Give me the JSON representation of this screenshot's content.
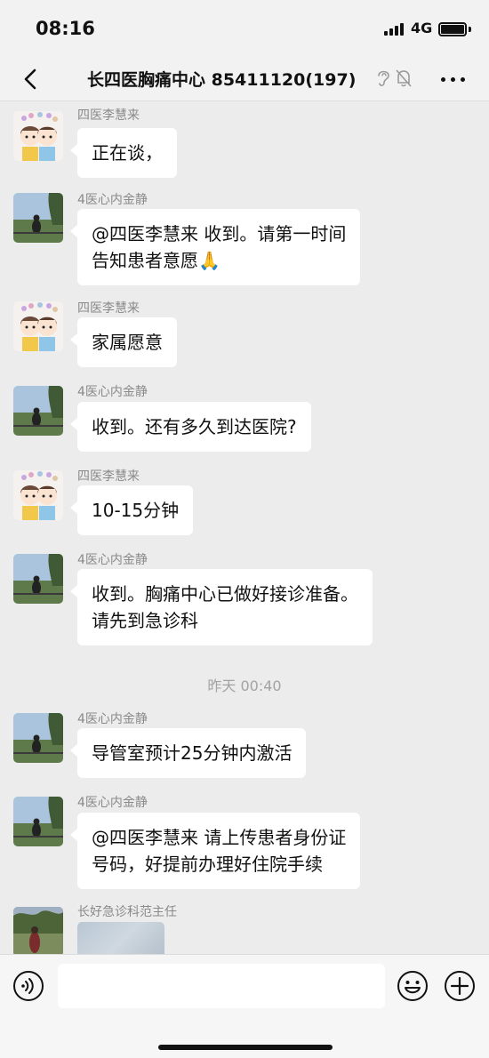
{
  "status_bar": {
    "time": "08:16",
    "network": "4G"
  },
  "header": {
    "title": "长四医胸痛中心 85411120(197)"
  },
  "messages": [
    {
      "sender": "四医李慧来",
      "text": "正在谈，",
      "avatar": "cartoon-couple"
    },
    {
      "sender": "4医心内金静",
      "line1": "@四医李慧来 收到。请第一时间",
      "line2": "告知患者意愿🙏",
      "avatar": "scenery"
    },
    {
      "sender": "四医李慧来",
      "text": "家属愿意",
      "avatar": "cartoon-couple"
    },
    {
      "sender": "4医心内金静",
      "text": "收到。还有多久到达医院?",
      "avatar": "scenery"
    },
    {
      "sender": "四医李慧来",
      "text": "10-15分钟",
      "avatar": "cartoon-couple"
    },
    {
      "sender": "4医心内金静",
      "line1": "收到。胸痛中心已做好接诊准备。",
      "line2": "请先到急诊科",
      "avatar": "scenery"
    },
    {
      "sender": "4医心内金静",
      "text": "导管室预计25分钟内激活",
      "avatar": "scenery"
    },
    {
      "sender": "4医心内金静",
      "line1": "@四医李慧来 请上传患者身份证",
      "line2": "号码，好提前办理好住院手续",
      "avatar": "scenery"
    },
    {
      "sender": "长好急诊科范主任",
      "avatar": "person-outdoor",
      "attachment": "image"
    }
  ],
  "timestamp": "昨天 00:40",
  "icons": {
    "back": "chevron-left-icon",
    "ear": "ear-icon",
    "mute": "bell-off-icon",
    "more": "more-icon",
    "voice": "voice-icon",
    "emoji": "emoji-icon",
    "plus": "plus-icon"
  },
  "colors": {
    "background": "#ececec",
    "bubble": "#ffffff",
    "sender_text": "#8a8a8a"
  }
}
